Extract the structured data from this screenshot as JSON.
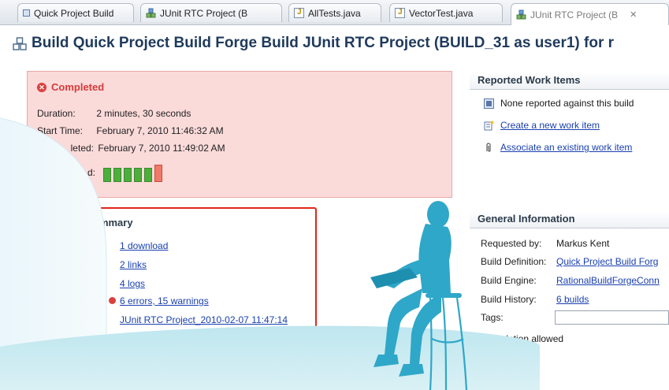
{
  "tabs": [
    {
      "label": "Quick Project Build",
      "icon": "square-icon"
    },
    {
      "label": "JUnit RTC Project (B",
      "icon": "build-icon"
    },
    {
      "label": "AllTests.java",
      "icon": "java-file-icon"
    },
    {
      "label": "VectorTest.java",
      "icon": "java-file-icon"
    },
    {
      "label": "JUnit RTC Project (B",
      "icon": "build-icon",
      "active": true,
      "close": "✕"
    }
  ],
  "header": {
    "title": "Build Quick Project Build Forge Build JUnit RTC Project (BUILD_31 as user1) for r"
  },
  "status": {
    "state": "Completed",
    "duration_label": "Duration:",
    "duration_value": "2 minutes, 30 seconds",
    "start_label": "Start Time:",
    "start_value": "February 7, 2010 11:46:32 AM",
    "completed_label": "leted:",
    "completed_value": "February 7, 2010 11:49:02 AM",
    "history_label": "d:",
    "history": [
      "ok",
      "ok",
      "ok",
      "ok",
      "ok",
      "fail"
    ],
    "colors": {
      "ok": "#4caf3c",
      "fail": "#f07a6a",
      "error": "#d43a3a"
    }
  },
  "summary": {
    "title": "ummary",
    "links": [
      "1 download",
      "2 links",
      "4 logs",
      "6 errors, 15 warnings",
      "JUnit RTC Project_2010-02-07 11:47:14"
    ]
  },
  "work_items": {
    "title": "Reported Work Items",
    "none_text": "None reported against this build",
    "create_link": "Create a new work item",
    "associate_link": "Associate an existing work item"
  },
  "general": {
    "title": "General Information",
    "requested_by_label": "Requested by:",
    "requested_by_value": "Markus Kent",
    "definition_label": "Build Definition:",
    "definition_value": "Quick Project Build Forg",
    "engine_label": "Build Engine:",
    "engine_value": "RationalBuildForgeConn",
    "history_label": "Build History:",
    "history_value": "6 builds",
    "tags_label": "Tags:",
    "deletion_label": "Deletion allowed"
  }
}
